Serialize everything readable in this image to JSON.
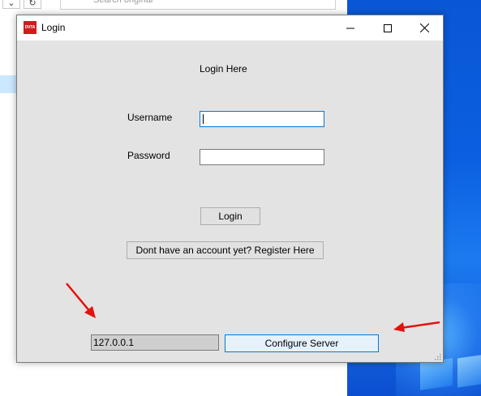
{
  "background": {
    "search_placeholder": "Search original"
  },
  "dialog": {
    "title": "Login",
    "app_icon_text": "DVTA",
    "heading": "Login Here",
    "username_label": "Username",
    "username_value": "",
    "password_label": "Password",
    "password_value": "",
    "login_button": "Login",
    "register_button": "Dont have an account yet? Register Here",
    "server_ip": "127.0.0.1",
    "configure_button": "Configure Server"
  },
  "colors": {
    "annotation_arrow": "#e3120b",
    "focus_border": "#0078d7",
    "dialog_bg": "#e3e3e3",
    "desktop_blue": "#0b5fe0"
  },
  "icons": {
    "minimize": "minimize-icon",
    "maximize": "maximize-icon",
    "close": "close-icon"
  }
}
